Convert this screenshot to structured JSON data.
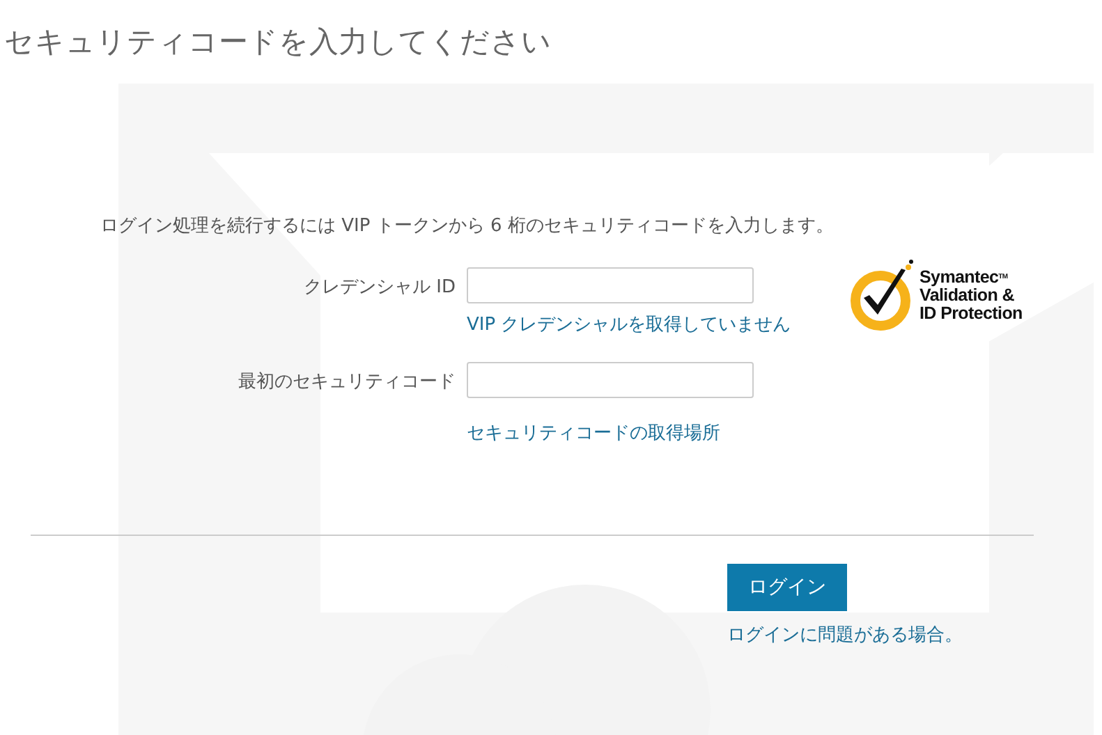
{
  "page": {
    "title": "セキュリティコードを入力してください"
  },
  "instructions": "ログイン処理を続行するには VIP トークンから 6 桁のセキュリティコードを入力します。",
  "fields": [
    {
      "label": "クレデンシャル ID",
      "link": "VIP クレデンシャルを取得していません"
    },
    {
      "label": "最初のセキュリティコード",
      "link": "セキュリティコードの取得場所"
    }
  ],
  "logo": {
    "lines": [
      "Symantec",
      "Validation &",
      "ID Protection"
    ],
    "trademark": "TM"
  },
  "login_button": "ログイン",
  "help_link": "ログインに問題がある場合。"
}
